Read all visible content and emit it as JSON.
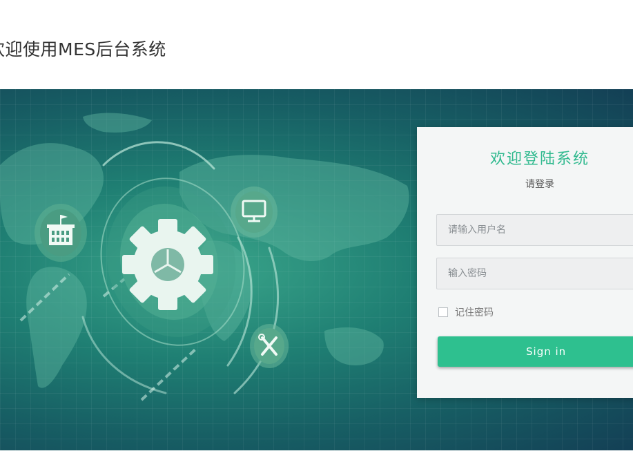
{
  "header": {
    "title": "欢迎使用MES后台系统"
  },
  "login": {
    "title": "欢迎登陆系统",
    "subtitle": "请登录",
    "username_placeholder": "请输入用户名",
    "password_placeholder": "输入密码",
    "remember_label": "记住密码",
    "signin_label": "Sign in"
  },
  "icons": [
    "building-icon",
    "monitor-icon",
    "gear-icon",
    "tools-icon",
    "world-map"
  ],
  "colors": {
    "accent": "#2ec08f",
    "banner_dark": "#133f55",
    "banner_light": "#3aa58a"
  }
}
